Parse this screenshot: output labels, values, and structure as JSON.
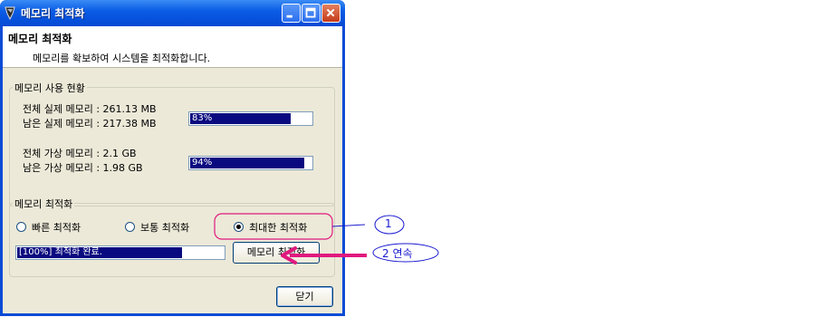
{
  "window": {
    "title": "메모리 최적화",
    "header_title": "메모리 최적화",
    "header_subtitle": "메모리를 확보하여 시스템을 최적화합니다."
  },
  "usage_group": {
    "title": "메모리 사용 현황",
    "physical_total": "전체 실제 메모리 : 261.13 MB",
    "physical_free": "남은 실제 메모리 : 217.38 MB",
    "physical_bar_text": "83%",
    "physical_percent": 83,
    "virtual_total": "전체 가상 메모리 : 2.1 GB",
    "virtual_free": "남은 가상 메모리 : 1.98 GB",
    "virtual_bar_text": "94%",
    "virtual_percent": 94
  },
  "optimize_group": {
    "title": "메모리 최적화",
    "options": [
      "빠른 최적화",
      "보통 최적화",
      "최대한 최적화"
    ],
    "selected": "최대한 최적화",
    "progress_text": "[100%] 최적화 완료.",
    "progress_percent": 100,
    "optimize_button": "메모리 최적화"
  },
  "close_button": "닫기",
  "annotations": {
    "circle_1": "1",
    "circle_2": "2 연속"
  },
  "colors": {
    "titlebar": "#0b5de6",
    "bar_fill": "#0a0a80",
    "annotation_pink": "#e0197e",
    "annotation_blue": "#1a1ad0"
  }
}
